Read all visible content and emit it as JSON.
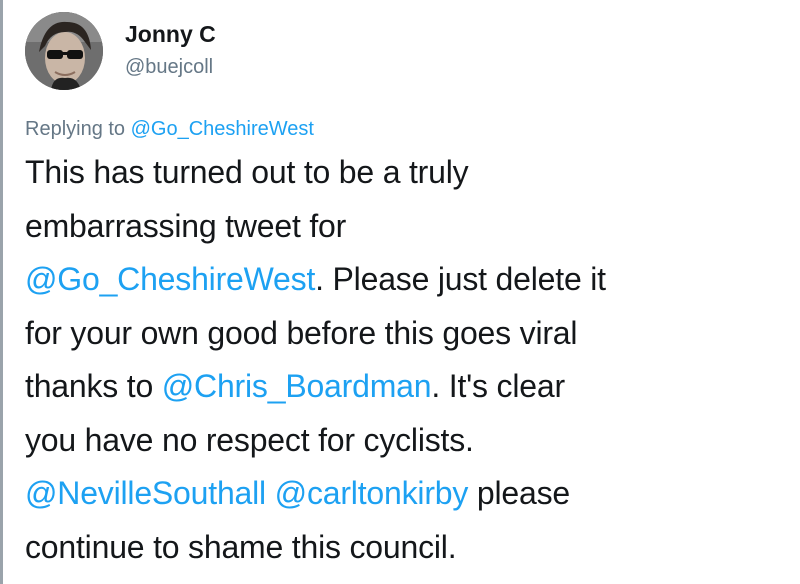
{
  "tweet": {
    "display_name": "Jonny C",
    "handle": "@buejcoll",
    "replying_prefix": "Replying to ",
    "replying_to": "@Go_CheshireWest",
    "lines": [
      [
        {
          "text": "This has turned out to be a truly",
          "link": false
        }
      ],
      [
        {
          "text": "embarrassing tweet for",
          "link": false
        }
      ],
      [
        {
          "text": "@Go_CheshireWest",
          "link": true
        },
        {
          "text": ". Please just delete it",
          "link": false
        }
      ],
      [
        {
          "text": "for your own good before this goes viral",
          "link": false
        }
      ],
      [
        {
          "text": "thanks to ",
          "link": false
        },
        {
          "text": "@Chris_Boardman",
          "link": true
        },
        {
          "text": ". It's clear",
          "link": false
        }
      ],
      [
        {
          "text": "you have no respect for cyclists.",
          "link": false
        }
      ],
      [
        {
          "text": "@NevilleSouthall",
          "link": true
        },
        {
          "text": " ",
          "link": false
        },
        {
          "text": "@carltonkirby",
          "link": true
        },
        {
          "text": " please",
          "link": false
        }
      ],
      [
        {
          "text": "continue to shame this council.",
          "link": false
        }
      ]
    ]
  },
  "colors": {
    "link": "#1da1f2",
    "muted": "#657786",
    "text": "#14171a"
  }
}
